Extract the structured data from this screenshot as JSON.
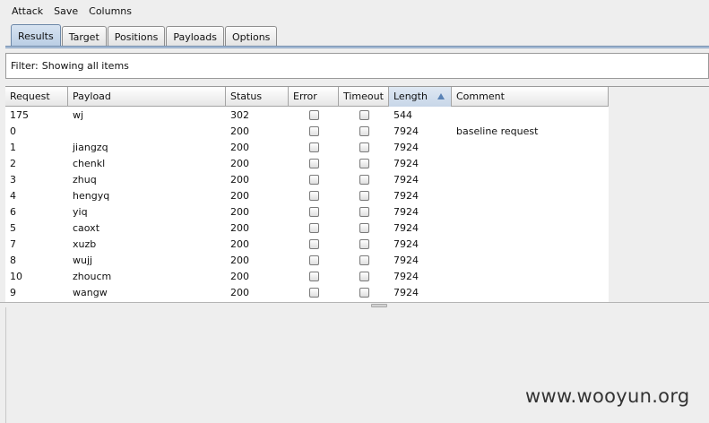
{
  "menubar": {
    "items": [
      "Attack",
      "Save",
      "Columns"
    ]
  },
  "tabs": [
    {
      "label": "Results",
      "active": true
    },
    {
      "label": "Target",
      "active": false
    },
    {
      "label": "Positions",
      "active": false
    },
    {
      "label": "Payloads",
      "active": false
    },
    {
      "label": "Options",
      "active": false
    }
  ],
  "filter": {
    "label": "Filter:",
    "value": "Showing all items"
  },
  "table": {
    "sort": {
      "column": "Length",
      "direction": "ascending"
    },
    "columns": [
      "Request",
      "Payload",
      "Status",
      "Error",
      "Timeout",
      "Length",
      "Comment"
    ],
    "rows": [
      {
        "request": "175",
        "payload": "wj",
        "status": "302",
        "error": false,
        "timeout": false,
        "length": "544",
        "comment": ""
      },
      {
        "request": "0",
        "payload": "",
        "status": "200",
        "error": false,
        "timeout": false,
        "length": "7924",
        "comment": "baseline request"
      },
      {
        "request": "1",
        "payload": "jiangzq",
        "status": "200",
        "error": false,
        "timeout": false,
        "length": "7924",
        "comment": ""
      },
      {
        "request": "2",
        "payload": "chenkl",
        "status": "200",
        "error": false,
        "timeout": false,
        "length": "7924",
        "comment": ""
      },
      {
        "request": "3",
        "payload": "zhuq",
        "status": "200",
        "error": false,
        "timeout": false,
        "length": "7924",
        "comment": ""
      },
      {
        "request": "4",
        "payload": "hengyq",
        "status": "200",
        "error": false,
        "timeout": false,
        "length": "7924",
        "comment": ""
      },
      {
        "request": "6",
        "payload": "yiq",
        "status": "200",
        "error": false,
        "timeout": false,
        "length": "7924",
        "comment": ""
      },
      {
        "request": "5",
        "payload": "caoxt",
        "status": "200",
        "error": false,
        "timeout": false,
        "length": "7924",
        "comment": ""
      },
      {
        "request": "7",
        "payload": "xuzb",
        "status": "200",
        "error": false,
        "timeout": false,
        "length": "7924",
        "comment": ""
      },
      {
        "request": "8",
        "payload": "wujj",
        "status": "200",
        "error": false,
        "timeout": false,
        "length": "7924",
        "comment": ""
      },
      {
        "request": "10",
        "payload": "zhoucm",
        "status": "200",
        "error": false,
        "timeout": false,
        "length": "7924",
        "comment": ""
      },
      {
        "request": "9",
        "payload": "wangw",
        "status": "200",
        "error": false,
        "timeout": false,
        "length": "7924",
        "comment": ""
      }
    ]
  },
  "watermark": "www.wooyun.org",
  "colors": {
    "active_tab": "#b9cde4",
    "sort_arrow": "#5a82b5"
  }
}
